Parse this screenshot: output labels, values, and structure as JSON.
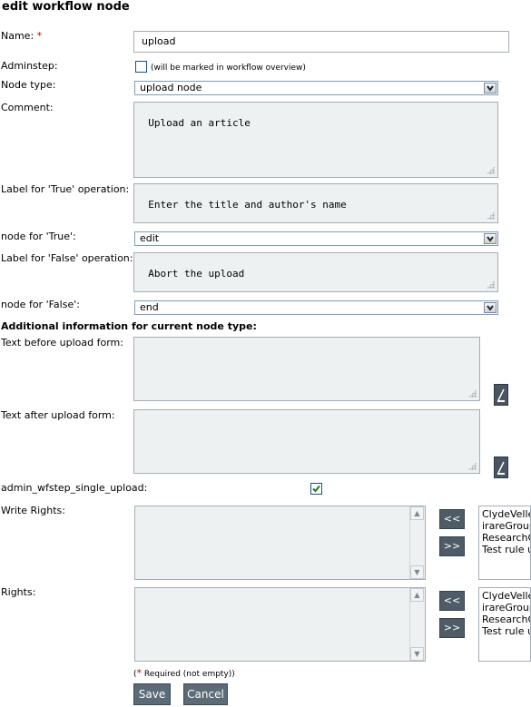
{
  "page": {
    "title": "edit workflow node"
  },
  "fields": {
    "name_label": "Name:",
    "required_star": "*",
    "name_value": "upload",
    "adminstep_label": "Adminstep:",
    "adminstep_note": "(will be marked in workflow overview)",
    "adminstep_checked": false,
    "nodetype_label": "Node type:",
    "nodetype_value": "upload node",
    "comment_label": "Comment:",
    "comment_value": "Upload an article",
    "true_label_label": "Label for 'True' operation:",
    "true_label_value": "Enter the title and author's name",
    "true_node_label": "node for 'True':",
    "true_node_value": "edit",
    "false_label_label": "Label for 'False' operation:",
    "false_label_value": "Abort the upload",
    "false_node_label": "node for 'False':",
    "false_node_value": "end"
  },
  "additional": {
    "heading": "Additional information for current node type:",
    "text_before_label": "Text before upload form:",
    "text_before_value": "",
    "text_after_label": "Text after upload form:",
    "text_after_value": "",
    "single_upload_label": "admin_wfstep_single_upload:",
    "single_upload_checked": true
  },
  "rights": {
    "write_label": "Write Rights:",
    "rights_label": "Rights:",
    "add_button": "<<",
    "remove_button": ">>",
    "write_available": [
      "ClydeVellen",
      "irareGroup",
      "ResearchG",
      "Test rule us"
    ],
    "read_available": [
      "ClydeVellen",
      "irareGroup",
      "ResearchG",
      "Test rule us"
    ]
  },
  "footer": {
    "required_star": "*",
    "required_note": " Required (not empty))",
    "required_open": "(",
    "save_label": "Save",
    "cancel_label": "Cancel"
  },
  "colors": {
    "accent_button": "#5b6b78",
    "required": "#cc0000",
    "textarea_bg": "#eef1f2"
  }
}
